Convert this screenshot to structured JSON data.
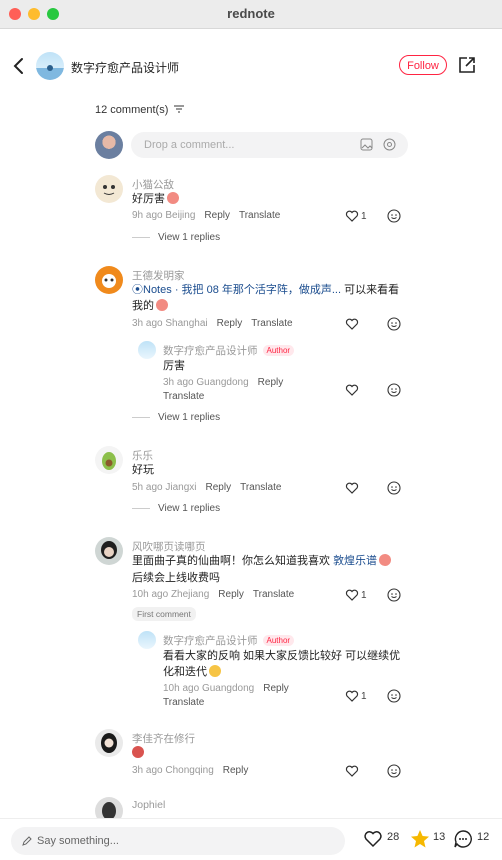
{
  "window": {
    "title": "rednote"
  },
  "header": {
    "author_name": "数字疗愈产品设计师",
    "follow_label": "Follow"
  },
  "comments_header": {
    "count_label": "12 comment(s)"
  },
  "compose": {
    "placeholder": "Drop a comment..."
  },
  "comments": [
    {
      "user": "小猫公敌",
      "text": "好厉害",
      "time": "9h ago",
      "location": "Beijing",
      "reply": "Reply",
      "translate": "Translate",
      "likes": "1",
      "view_replies": "View 1 replies"
    },
    {
      "user": "王德发明家",
      "notes_label": "Notes",
      "notes_text": "· 我把 08 年那个活字阵，做成声...",
      "text_tail": "可以来看看",
      "text_line2": "我的",
      "time": "3h ago",
      "location": "Shanghai",
      "reply": "Reply",
      "translate": "Translate",
      "likes": "",
      "sub": {
        "user": "数字疗愈产品设计师",
        "badge": "Author",
        "text": "厉害",
        "time": "3h ago",
        "location": "Guangdong",
        "reply": "Reply",
        "translate": "Translate"
      },
      "view_replies": "View 1 replies"
    },
    {
      "user": "乐乐",
      "text": "好玩",
      "time": "5h ago",
      "location": "Jiangxi",
      "reply": "Reply",
      "translate": "Translate",
      "likes": "",
      "view_replies": "View 1 replies"
    },
    {
      "user": "风吹哪页读哪页",
      "text": "里面曲子真的仙曲啊！你怎么知道我喜欢",
      "link": "敦煌乐谱",
      "text_line2": "后续会上线收费吗",
      "time": "10h ago",
      "location": "Zhejiang",
      "reply": "Reply",
      "translate": "Translate",
      "likes": "1",
      "first_badge": "First comment",
      "sub": {
        "user": "数字疗愈产品设计师",
        "badge": "Author",
        "text": "看看大家的反响 如果大家反馈比较好 可以继续优",
        "text_line2": "化和迭代",
        "time": "10h ago",
        "location": "Guangdong",
        "reply": "Reply",
        "translate": "Translate",
        "likes": "1"
      }
    },
    {
      "user": "李佳齐在修行",
      "text": "",
      "time": "3h ago",
      "location": "Chongqing",
      "reply": "Reply",
      "likes": ""
    },
    {
      "user": "Jophiel",
      "text": ""
    }
  ],
  "footer": {
    "say_placeholder": "Say something...",
    "likes": "28",
    "stars": "13",
    "comments": "12"
  }
}
